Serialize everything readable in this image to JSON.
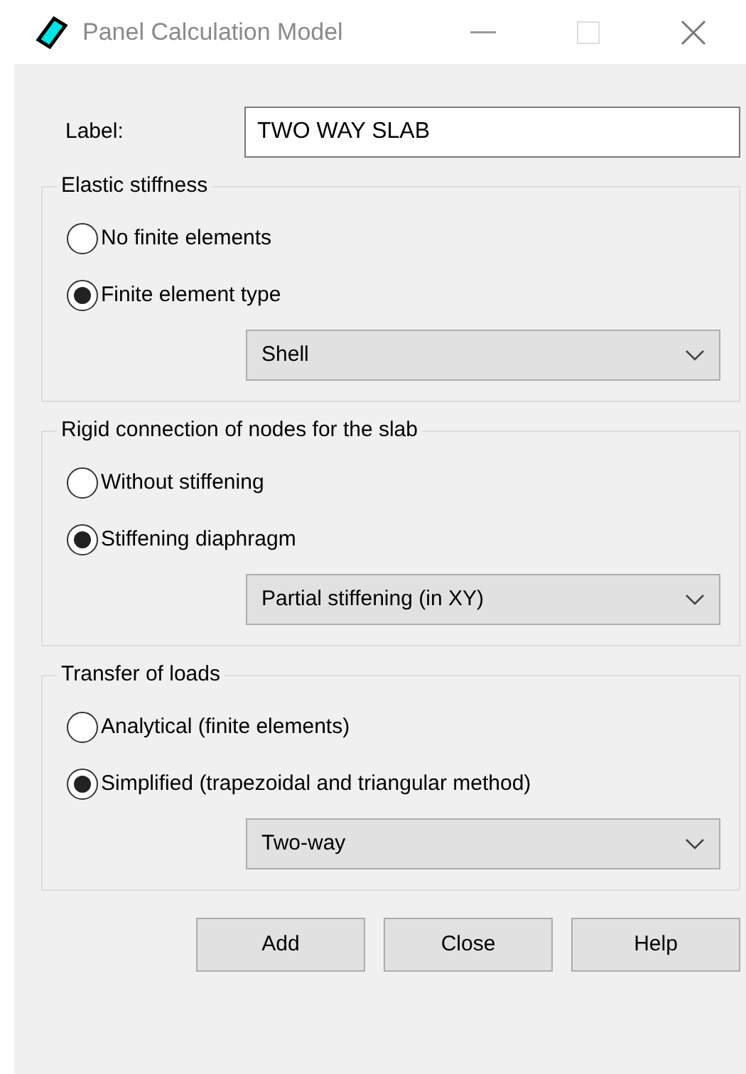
{
  "window": {
    "title": "Panel Calculation Model"
  },
  "label_field": {
    "label": "Label:",
    "value": "TWO WAY SLAB"
  },
  "groups": [
    {
      "title": "Elastic stiffness",
      "options": [
        {
          "label": "No finite elements",
          "selected": false
        },
        {
          "label": "Finite element type",
          "selected": true
        }
      ],
      "dropdown": {
        "value": "Shell"
      }
    },
    {
      "title": "Rigid connection of nodes for the slab",
      "options": [
        {
          "label": "Without stiffening",
          "selected": false
        },
        {
          "label": "Stiffening diaphragm",
          "selected": true
        }
      ],
      "dropdown": {
        "value": "Partial stiffening (in XY)"
      }
    },
    {
      "title": "Transfer of loads",
      "options": [
        {
          "label": "Analytical (finite elements)",
          "selected": false
        },
        {
          "label": "Simplified (trapezoidal and triangular method)",
          "selected": true
        }
      ],
      "dropdown": {
        "value": "Two-way"
      }
    }
  ],
  "buttons": [
    "Add",
    "Close",
    "Help"
  ]
}
